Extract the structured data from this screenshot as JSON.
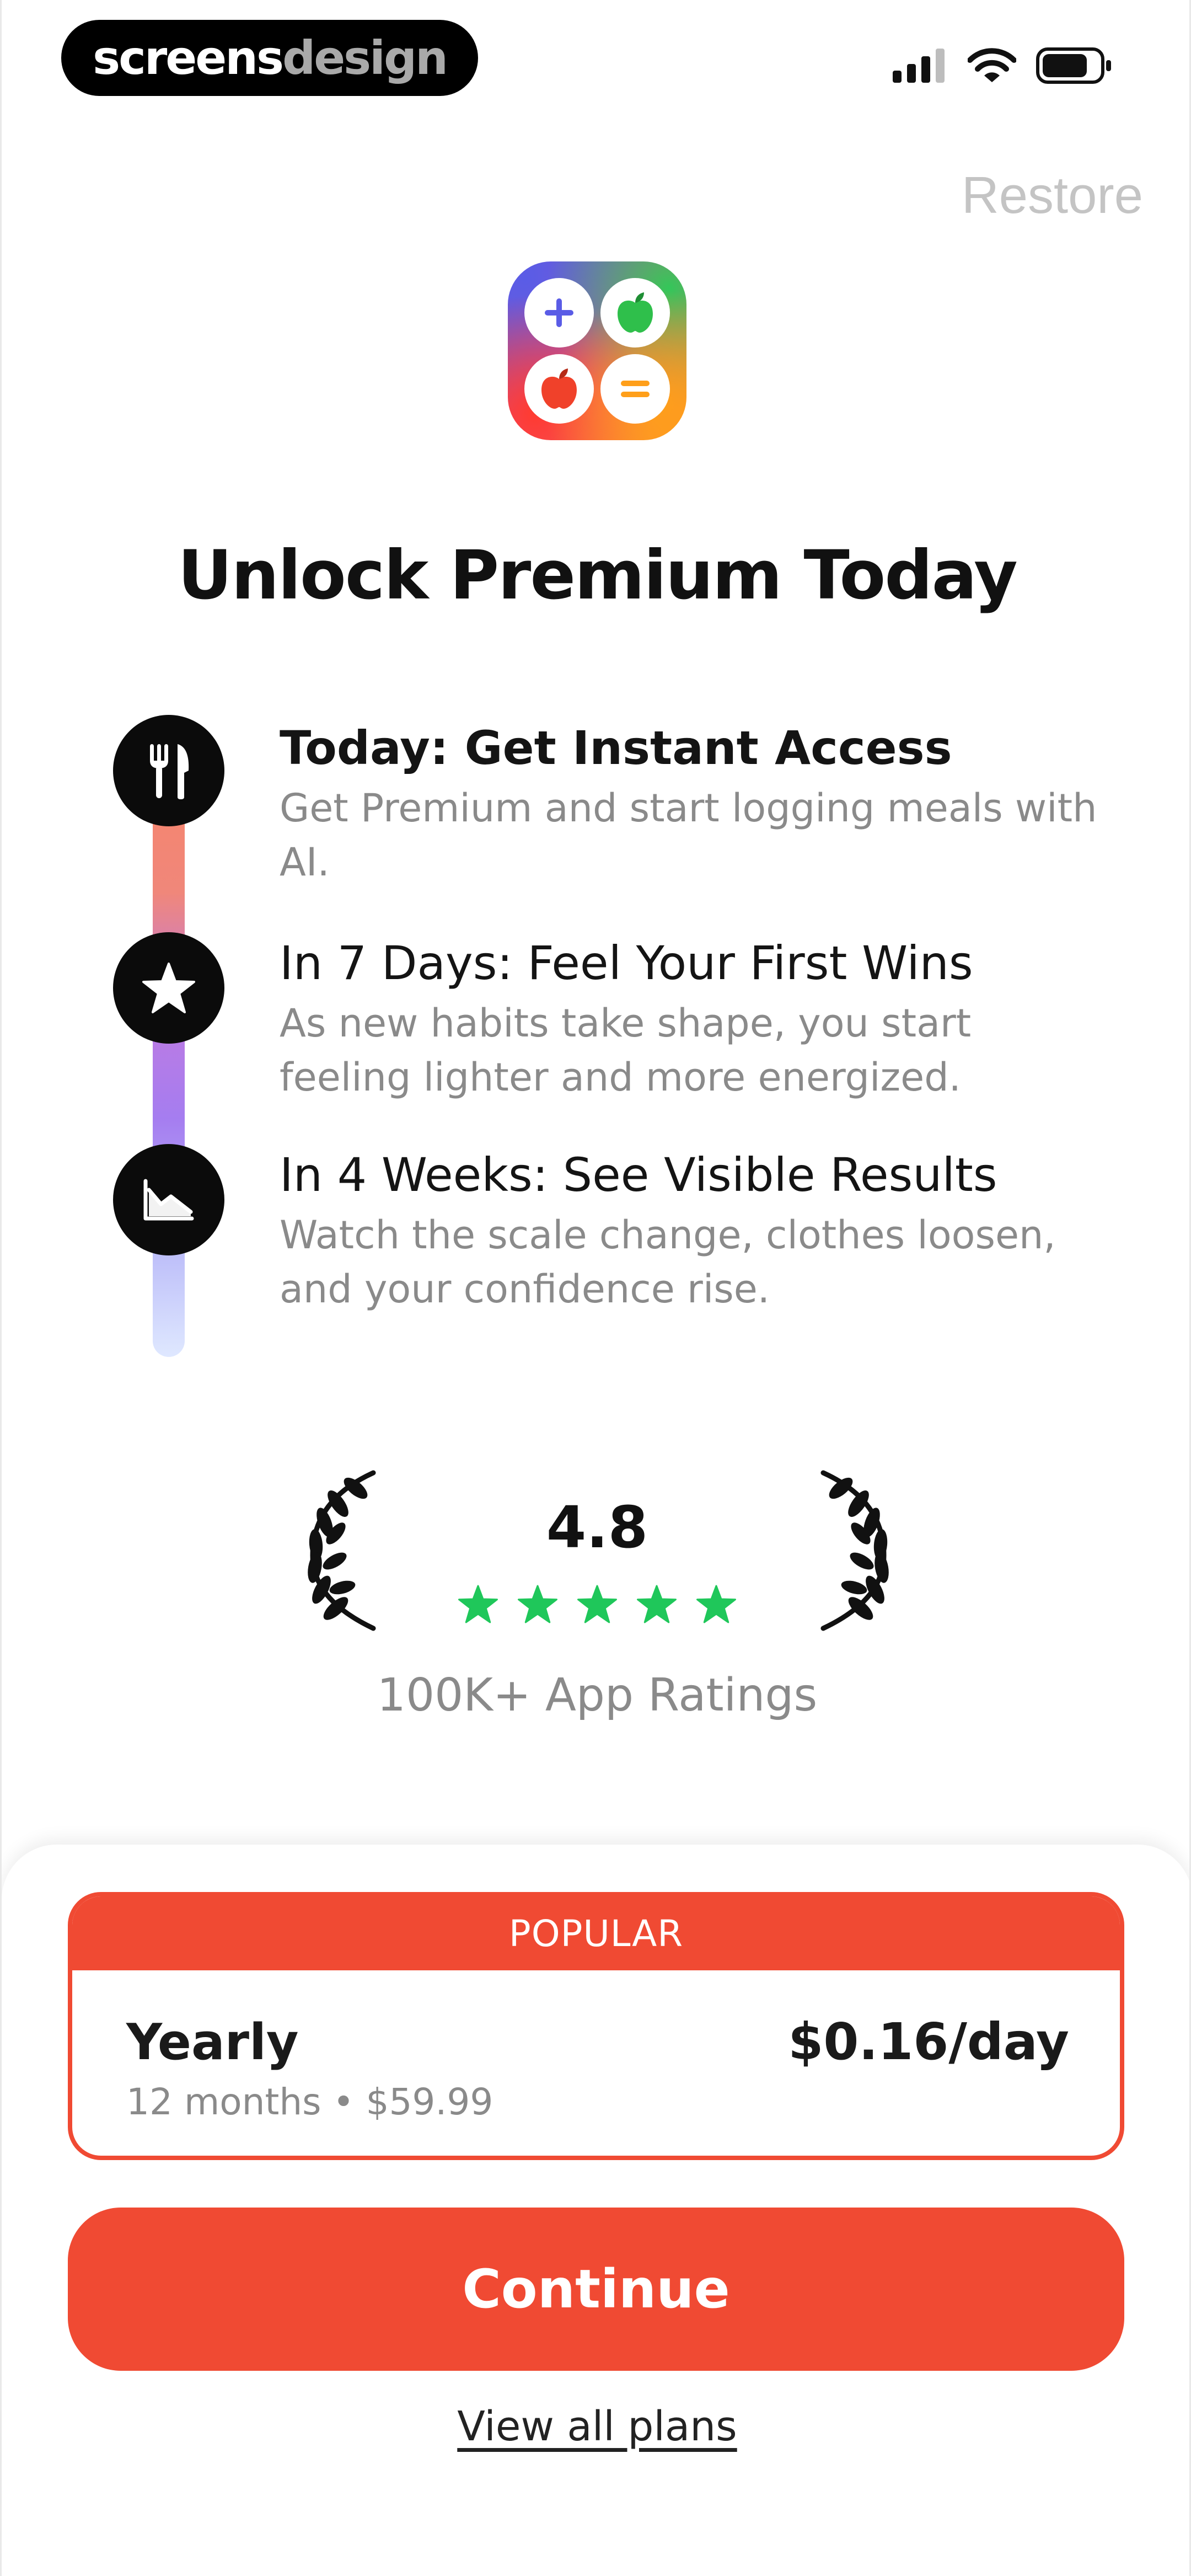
{
  "status_bar": {
    "brand_part1": "screens",
    "brand_part2": "design",
    "icons": [
      "cellular-signal-icon",
      "wifi-icon",
      "battery-icon"
    ]
  },
  "header": {
    "restore_label": "Restore"
  },
  "app_icon": {
    "name": "calculator-apple-app-icon",
    "cells": [
      "plus-icon",
      "green-apple-icon",
      "red-apple-icon",
      "equals-icon"
    ]
  },
  "title": "Unlock Premium Today",
  "timeline": [
    {
      "icon": "fork-knife-icon",
      "title": "Today: Get Instant Access",
      "description": "Get Premium and start logging meals with AI."
    },
    {
      "icon": "star-icon",
      "title": "In 7 Days: Feel Your First Wins",
      "description": "As new habits take shape, you start feeling lighter and more energized."
    },
    {
      "icon": "trend-down-chart-icon",
      "title": "In 4 Weeks: See Visible Results",
      "description": "Watch the scale change, clothes loosen, and your confidence rise."
    }
  ],
  "rating": {
    "value": "4.8",
    "stars": 5,
    "star_color": "#1fc75a",
    "label": "100K+ App Ratings"
  },
  "plan": {
    "badge": "POPULAR",
    "name": "Yearly",
    "detail": "12 months • $59.99",
    "price": "$0.16/day",
    "selected": true
  },
  "actions": {
    "continue_label": "Continue",
    "view_all_label": "View all plans"
  },
  "colors": {
    "accent": "#f04a33",
    "text_primary": "#111111",
    "text_secondary": "#8a8a8a",
    "restore": "#c4c4c4"
  }
}
